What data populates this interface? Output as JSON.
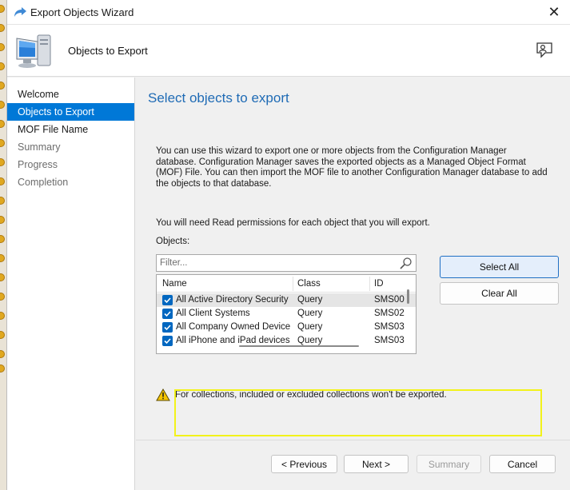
{
  "window": {
    "title": "Export Objects Wizard"
  },
  "header": {
    "title": "Objects to Export"
  },
  "sidebar": {
    "items": [
      {
        "label": "Welcome",
        "state": "done"
      },
      {
        "label": "Objects to Export",
        "state": "active"
      },
      {
        "label": "MOF File Name",
        "state": "done"
      },
      {
        "label": "Summary",
        "state": "pending"
      },
      {
        "label": "Progress",
        "state": "pending"
      },
      {
        "label": "Completion",
        "state": "pending"
      }
    ]
  },
  "main": {
    "heading": "Select objects to export",
    "description": "You can use this wizard to export one or more objects from the Configuration Manager database. Configuration Manager saves the exported objects as a Managed Object Format (MOF) File. You can then import the MOF file to another Configuration Manager database to add the objects to that database.",
    "permissions_note": "You will need Read permissions for each object that you will export.",
    "objects_label": "Objects:",
    "filter": {
      "placeholder": "Filter...",
      "value": ""
    },
    "grid": {
      "columns": [
        "Name",
        "Class",
        "ID"
      ],
      "rows": [
        {
          "name": "All Active Directory Security ...",
          "class": "Query",
          "id": "SMS00",
          "checked": true,
          "selected": true
        },
        {
          "name": "All Client Systems",
          "class": "Query",
          "id": "SMS02",
          "checked": true,
          "selected": false
        },
        {
          "name": "All Company Owned Devices",
          "class": "Query",
          "id": "SMS03",
          "checked": true,
          "selected": false
        },
        {
          "name": "All iPhone and iPad devices",
          "class": "Query",
          "id": "SMS03",
          "checked": true,
          "selected": false
        }
      ]
    },
    "select_all_label": "Select All",
    "clear_all_label": "Clear All",
    "warning": "For collections, included or excluded collections won't be exported."
  },
  "footer": {
    "previous_label": "< Previous",
    "next_label": "Next >",
    "summary_label": "Summary",
    "cancel_label": "Cancel"
  },
  "icons": {
    "app": "wizard-arrow-icon",
    "header": "computer-icon",
    "help": "person-help-icon",
    "filter": "search-icon",
    "warning": "warning-icon",
    "close": "close-icon"
  },
  "colors": {
    "accent": "#0078d7",
    "heading": "#1f6bb5",
    "highlight_box": "#f2f21a",
    "warning": "#f5c400"
  }
}
